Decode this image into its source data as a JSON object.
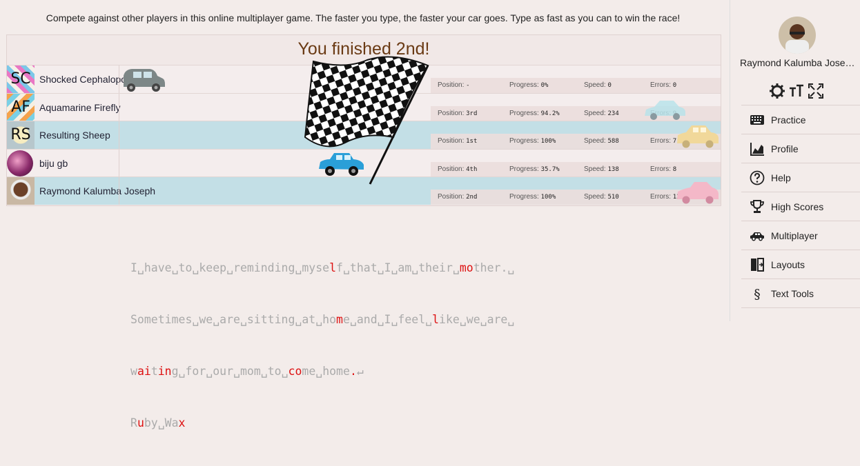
{
  "intro_text": "Compete against other players in this online multiplayer game. The faster you type, the faster your car goes. Type as fast as you can to win the race!",
  "finish_message": "You finished 2nd!",
  "stat_labels": {
    "position": "Position:",
    "progress": "Progress:",
    "speed": "Speed:",
    "errors": "Errors:"
  },
  "players": [
    {
      "avatar": "SC",
      "name": "Shocked Cephalopod",
      "position": "-",
      "progress": "0%",
      "speed": "0",
      "errors": "0",
      "car_color": "#7d8787"
    },
    {
      "avatar": "AF",
      "name": "Aquamarine Firefly",
      "position": "3rd",
      "progress": "94.2%",
      "speed": "234",
      "errors": "9",
      "car_color": "#b8e3ea"
    },
    {
      "avatar": "RS",
      "name": "Resulting Sheep",
      "position": "1st",
      "progress": "100%",
      "speed": "588",
      "errors": "7",
      "car_color": "#f1d89a"
    },
    {
      "avatar": "",
      "name": "biju gb",
      "position": "4th",
      "progress": "35.7%",
      "speed": "138",
      "errors": "8",
      "car_color": "#2a9fd8"
    },
    {
      "avatar": "",
      "name": "Raymond Kalumba Joseph",
      "position": "2nd",
      "progress": "100%",
      "speed": "510",
      "errors": "13",
      "car_color": "#f4b8c8"
    }
  ],
  "typing_text": {
    "lines": [
      "I␣have␣to␣keep␣reminding␣myself␣that␣I␣am␣their␣mother.␣",
      "Sometimes␣we␣are␣sitting␣at␣home␣and␣I␣feel␣like␣we␣are␣",
      "waiting␣for␣our␣mom␣to␣come␣home.↵",
      "Ruby␣Wax"
    ]
  },
  "sidebar": {
    "user_name": "Raymond Kalumba Jose…",
    "toolbar": [
      {
        "icon": "gear-icon"
      },
      {
        "icon": "text-size-icon"
      },
      {
        "icon": "fullscreen-icon"
      }
    ],
    "menu": [
      {
        "label": "Practice",
        "icon": "keyboard-icon"
      },
      {
        "label": "Profile",
        "icon": "chart-icon"
      },
      {
        "label": "Help",
        "icon": "help-icon"
      },
      {
        "label": "High Scores",
        "icon": "trophy-icon"
      },
      {
        "label": "Multiplayer",
        "icon": "car-icon"
      },
      {
        "label": "Layouts",
        "icon": "layouts-icon"
      },
      {
        "label": "Text Tools",
        "icon": "section-icon"
      }
    ]
  }
}
